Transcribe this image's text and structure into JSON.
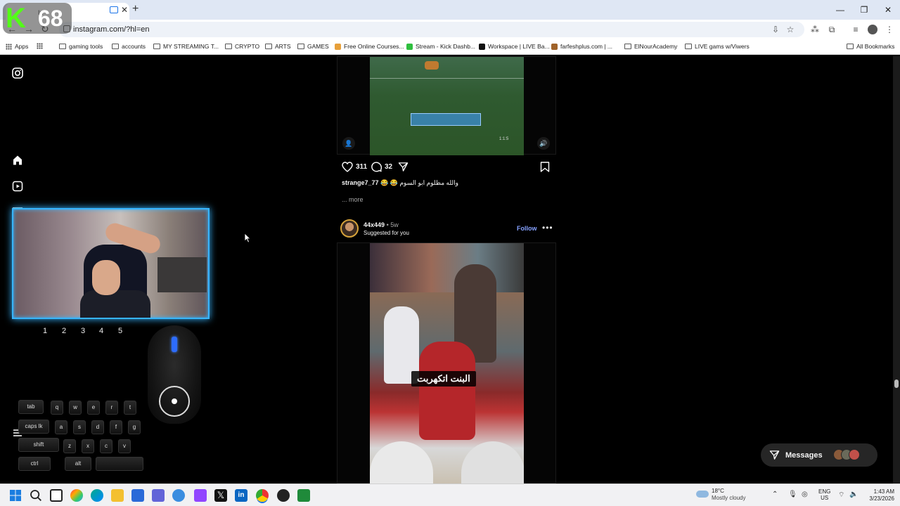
{
  "browser": {
    "tab_title": "In",
    "url": "instagram.com/?hl=en",
    "apps_label": "Apps",
    "all_bookmarks": "All Bookmarks",
    "bookmarks": [
      "gaming tools",
      "accounts",
      "MY STREAMING T...",
      "CRYPTO",
      "ARTS",
      "GAMES",
      "Free Online Courses...",
      "Stream - Kick Dashb...",
      "Workspace | LIVE Ba...",
      "farfeshplus.com | ...",
      "ElNourAcademy",
      "LIVE gams w/Viwers"
    ],
    "colors": {
      "tabbar": "#dfe7f4",
      "accent": "#1a73e8"
    }
  },
  "overlay": {
    "viewer_count": "68",
    "keys": {
      "row_numbers": [
        "1",
        "2",
        "3",
        "4",
        "5"
      ],
      "row1": [
        "tab",
        "q",
        "w",
        "e",
        "r",
        "t"
      ],
      "row2": [
        "caps lk",
        "a",
        "s",
        "d",
        "f",
        "g"
      ],
      "row3": [
        "shift",
        "z",
        "x",
        "c",
        "v"
      ],
      "row4": [
        "ctrl",
        "alt"
      ]
    }
  },
  "post1": {
    "likes": "311",
    "comments": "32",
    "username": "strange7_77",
    "caption_text": "😂 😂 والله مظلوم ابو السوم",
    "more": "... more",
    "game_text": "1:1:5"
  },
  "post2": {
    "username": "44x449",
    "age": "• 5w",
    "suggested": "Suggested for you",
    "follow": "Follow",
    "subtitle": "البنت اتكهربت"
  },
  "messages": {
    "label": "Messages"
  },
  "taskbar": {
    "temp": "18°C",
    "condition": "Mostly cloudy",
    "lang_line1": "ENG",
    "lang_line2": "US",
    "time": "1:43 AM",
    "date": "3/23/2026"
  }
}
